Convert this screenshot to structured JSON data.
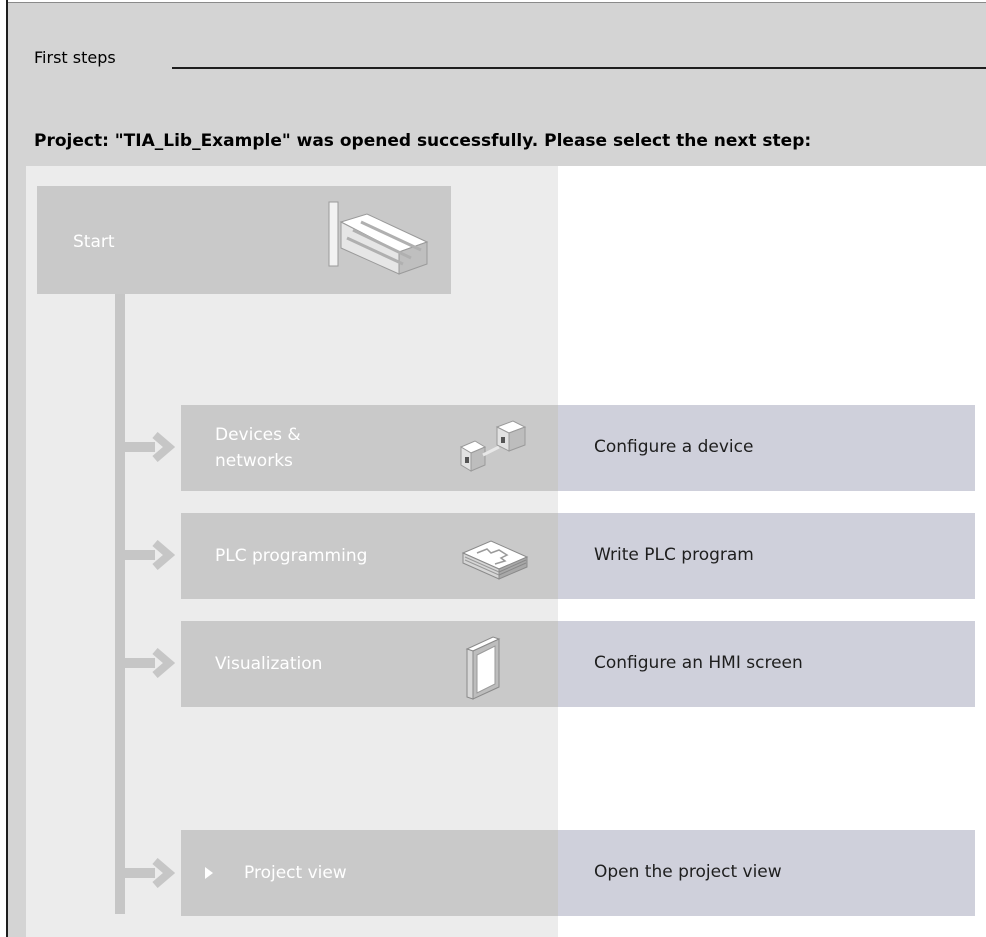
{
  "portal": {
    "section_title": "First steps",
    "status_message": "Project: \"TIA_Lib_Example\" was opened successfully. Please select the next step:"
  },
  "start": {
    "label": "Start",
    "icon": "stairs-icon"
  },
  "steps": [
    {
      "label": "Devices & networks",
      "label_line1": "Devices &",
      "label_line2": "networks",
      "icon": "devices-networks-icon",
      "description": "Configure a device"
    },
    {
      "label": "PLC programming",
      "icon": "plc-programming-icon",
      "description": "Write PLC program"
    },
    {
      "label": "Visualization",
      "icon": "visualization-icon",
      "description": "Configure an HMI screen"
    }
  ],
  "project_view": {
    "label": "Project view",
    "icon": "play-triangle-icon",
    "description": "Open the project view"
  },
  "colors": {
    "background": "#d4d4d4",
    "tile": "#c9c9c9",
    "description_band": "#cfd0db",
    "tree_line": "#c6c6c6",
    "tile_text": "#ffffff"
  }
}
